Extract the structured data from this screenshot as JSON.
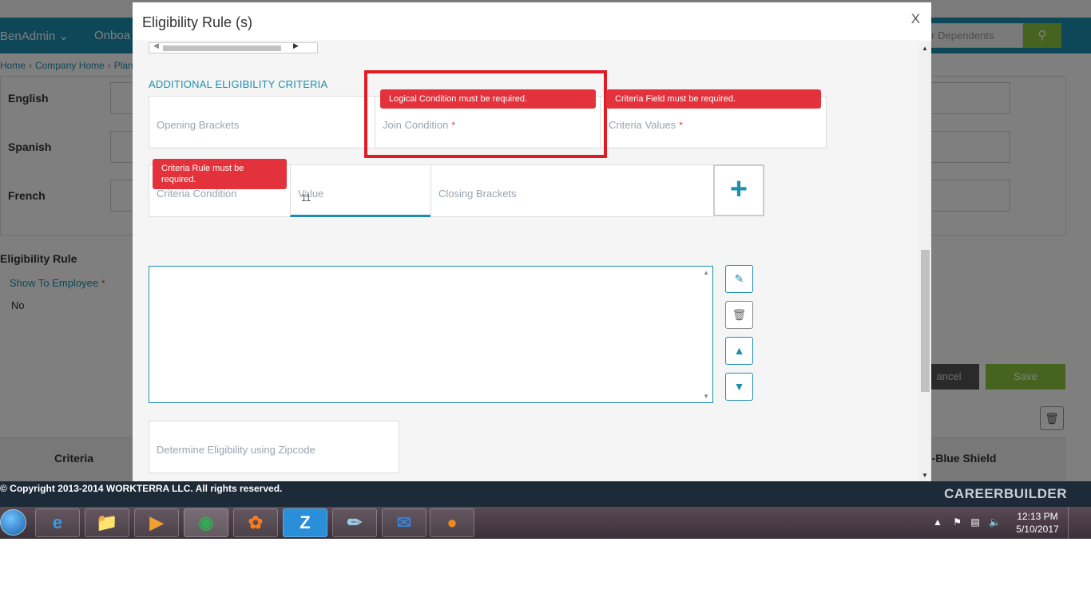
{
  "background": {
    "nav": {
      "benadmin": "BenAdmin",
      "onboarding": "Onboa"
    },
    "search": {
      "placeholder": "or Dependents"
    },
    "breadcrumb": {
      "home": "Home",
      "company_home": "Company Home",
      "plan": "Plan"
    },
    "languages": [
      "English",
      "Spanish",
      "French"
    ],
    "section_title": "Eligibility Rule",
    "show_to_employee": {
      "label": "Show To Employee",
      "value": "No"
    },
    "buttons": {
      "cancel": "ancel",
      "save": "Save"
    },
    "table": {
      "col_criteria": "Criteria",
      "col_plan": "n-Blue Shield"
    },
    "footer": {
      "copyright": "© Copyright 2013-2014 WORKTERRA LLC. All rights reserved.",
      "brand": "CAREERBUILDER"
    }
  },
  "modal": {
    "title": "Eligibility Rule (s)",
    "close_label": "X",
    "section_heading": "ADDITIONAL ELIGIBILITY CRITERIA",
    "fields": {
      "opening_brackets": "Opening Brackets",
      "join_condition": "Join Condition",
      "criteria_values": "Criteria Values",
      "criteria_condition": "Criteria Condition",
      "value_label": "Value",
      "value_input": "11",
      "closing_brackets": "Closing Brackets",
      "zipcode": "Determine Eligibility using Zipcode"
    },
    "required_mark": "*",
    "errors": {
      "logical_condition": "Logical Condition must be required.",
      "criteria_field": "Criteria Field must be required.",
      "criteria_rule": "Criteria Rule must be required."
    },
    "add_button": "+",
    "icons": [
      "pencil-icon",
      "trash-icon",
      "caret-up-icon",
      "caret-down-icon",
      "plus-icon"
    ]
  },
  "taskbar": {
    "apps": [
      "internet-explorer",
      "file-explorer",
      "media-player",
      "chrome",
      "firefox",
      "zoom",
      "notepad",
      "thunderbird",
      "app"
    ],
    "clock": {
      "time": "12:13 PM",
      "date": "5/10/2017"
    }
  },
  "colors": {
    "accent": "#1c8fae",
    "error": "#e3323b",
    "save_green": "#8cc63f",
    "footer": "#1d2a38"
  }
}
